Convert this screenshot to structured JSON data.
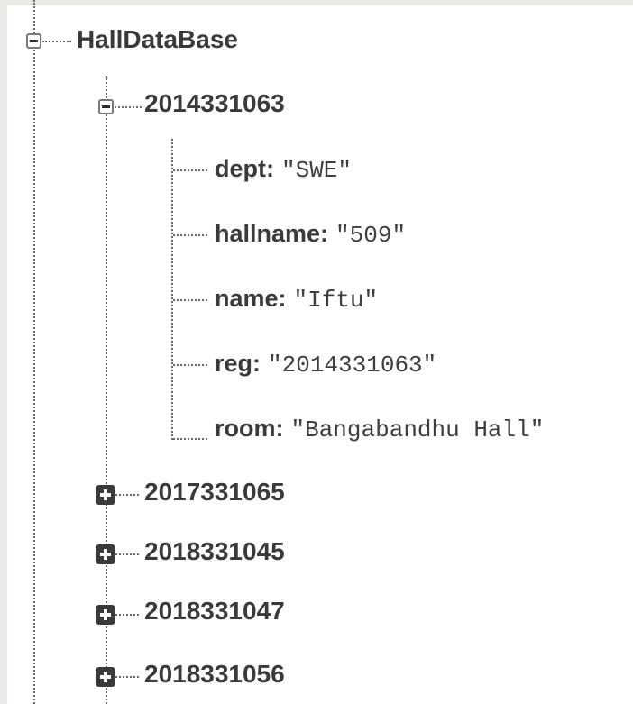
{
  "tree": {
    "root": {
      "label": "HallDataBase",
      "expanded": true,
      "children": [
        {
          "label": "2014331063",
          "expanded": true,
          "fields": [
            {
              "key": "dept:",
              "value": "\"SWE\""
            },
            {
              "key": "hallname:",
              "value": "\"509\""
            },
            {
              "key": "name:",
              "value": "\"Iftu\""
            },
            {
              "key": "reg:",
              "value": "\"2014331063\""
            },
            {
              "key": "room:",
              "value": "\"Bangabandhu Hall\""
            }
          ]
        },
        {
          "label": "2017331065",
          "expanded": false
        },
        {
          "label": "2018331045",
          "expanded": false
        },
        {
          "label": "2018331047",
          "expanded": false
        },
        {
          "label": "2018331056",
          "expanded": false
        }
      ]
    }
  }
}
